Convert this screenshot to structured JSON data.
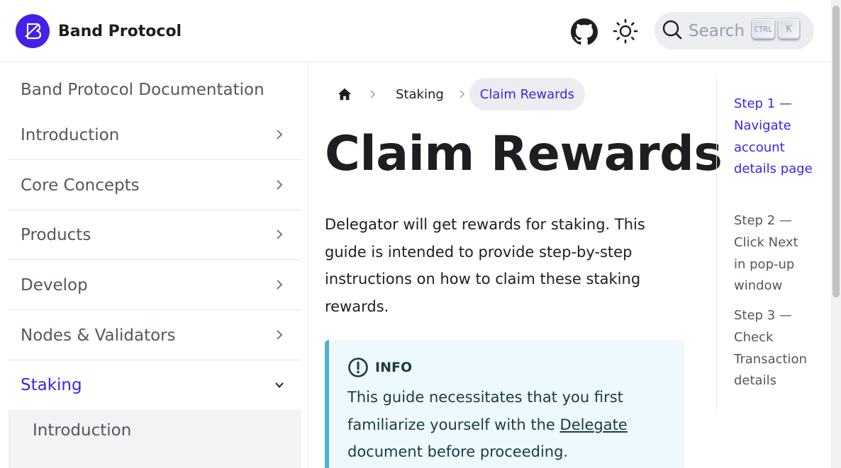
{
  "navbar": {
    "brand_title": "Band Protocol",
    "search_placeholder": "Search",
    "search_key_ctrl": "CTRL",
    "search_key_k": "K"
  },
  "colors": {
    "accent": "#4520e6",
    "admonition_border": "#4cb3d4",
    "admonition_bg": "#eef9fd"
  },
  "sidebar": {
    "root_label": "Band Protocol Documentation",
    "items": [
      {
        "label": "Introduction",
        "icon": "chevron-right-icon"
      },
      {
        "label": "Core Concepts",
        "icon": "chevron-right-icon"
      },
      {
        "label": "Products",
        "icon": "chevron-right-icon"
      },
      {
        "label": "Develop",
        "icon": "chevron-right-icon"
      },
      {
        "label": "Nodes & Validators",
        "icon": "chevron-right-icon"
      },
      {
        "label": "Staking",
        "icon": "chevron-down-icon",
        "active": true
      }
    ],
    "sub_items": [
      {
        "label": "Introduction"
      }
    ]
  },
  "breadcrumbs": {
    "home_icon": "home-icon",
    "items": [
      "Staking",
      "Claim Rewards"
    ]
  },
  "page": {
    "title": "Claim Rewards",
    "intro": "Delegator will get rewards for staking. This guide is intended to provide step-by-step instructions on how to claim these staking rewards."
  },
  "admonition": {
    "icon": "info-icon",
    "title": "INFO",
    "text_before": "This guide necessitates that you first familiarize yourself with the ",
    "link_text": "Delegate",
    "text_after": " document before proceeding."
  },
  "toc": {
    "items": [
      {
        "label": "Step 1 — Navigate account details page",
        "active": true
      },
      {
        "label": "Step 2 — Click Next in pop-up window",
        "active": false
      },
      {
        "label": "Step 3 — Check Transaction details",
        "active": false
      }
    ]
  }
}
